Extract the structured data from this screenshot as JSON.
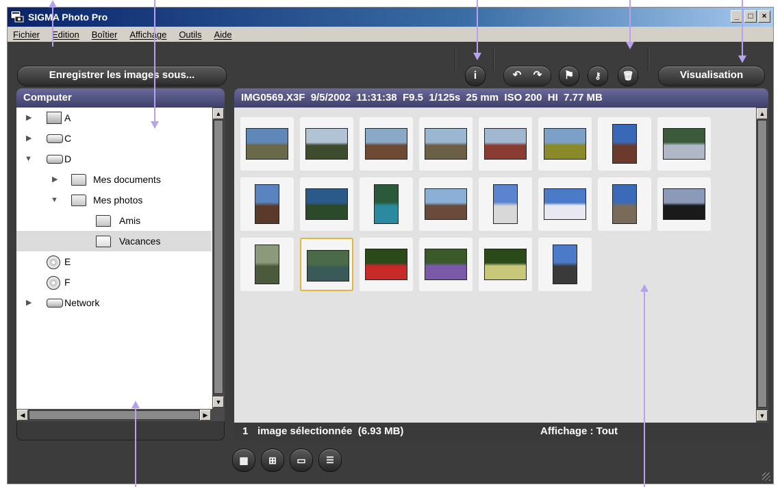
{
  "window": {
    "title": "SIGMA Photo Pro"
  },
  "menu": [
    "Fichier",
    "Edition",
    "Boîtier",
    "Affichage",
    "Outils",
    "Aide"
  ],
  "toolbar": {
    "save_label": "Enregistrer les images sous...",
    "view_label": "Visualisation",
    "icons": [
      "info-icon",
      "rotate-left-icon",
      "rotate-right-icon",
      "flag-icon",
      "key-icon",
      "trash-icon"
    ]
  },
  "tree": {
    "header": "Computer",
    "items": [
      {
        "label": "A",
        "icon": "floppy-icon",
        "expander": "collapsed"
      },
      {
        "label": "C",
        "icon": "drive-icon",
        "expander": "collapsed"
      },
      {
        "label": "D",
        "icon": "drive-icon",
        "expander": "expanded"
      },
      {
        "label": "Mes documents",
        "icon": "folder-icon",
        "expander": "collapsed"
      },
      {
        "label": "Mes photos",
        "icon": "folder-icon",
        "expander": "expanded"
      },
      {
        "label": "Amis",
        "icon": "folder-icon",
        "expander": "none"
      },
      {
        "label": "Vacances",
        "icon": "open-folder-icon",
        "expander": "none",
        "selected": true
      },
      {
        "label": "E",
        "icon": "cd-drive-icon",
        "expander": "none"
      },
      {
        "label": "F",
        "icon": "cd-drive-icon",
        "expander": "none"
      },
      {
        "label": "Network",
        "icon": "drive-icon",
        "expander": "collapsed"
      }
    ]
  },
  "image_info": "IMG0569.X3F  9/5/2002  11:31:38  F9.5  1/125s  25 mm  ISO 200  HI  7.77 MB",
  "thumbnails": [
    {
      "orient": "landscape",
      "colors": [
        "#5f88b8",
        "#6a6a4a"
      ]
    },
    {
      "orient": "landscape",
      "colors": [
        "#b0c4d6",
        "#3c4c2c"
      ]
    },
    {
      "orient": "landscape",
      "colors": [
        "#8aa8c8",
        "#6e4a34"
      ]
    },
    {
      "orient": "landscape",
      "colors": [
        "#9ab6d0",
        "#6b6046"
      ]
    },
    {
      "orient": "landscape",
      "colors": [
        "#a0b8d0",
        "#8a3c32"
      ]
    },
    {
      "orient": "landscape",
      "colors": [
        "#7da0c8",
        "#8a8a2a"
      ]
    },
    {
      "orient": "portrait",
      "colors": [
        "#3a68b8",
        "#6a3a2a"
      ]
    },
    {
      "orient": "landscape",
      "colors": [
        "#3a5a3a",
        "#b0b8c8"
      ]
    },
    {
      "orient": "portrait",
      "colors": [
        "#5a84c0",
        "#5a3a2a"
      ]
    },
    {
      "orient": "landscape",
      "colors": [
        "#2a5a8a",
        "#2a4a2a"
      ]
    },
    {
      "orient": "portrait",
      "colors": [
        "#2a5a3a",
        "#2a8aa0"
      ]
    },
    {
      "orient": "landscape",
      "colors": [
        "#8ab0d8",
        "#6a4a3a"
      ]
    },
    {
      "orient": "portrait",
      "colors": [
        "#5a84d0",
        "#d8d8d8"
      ]
    },
    {
      "orient": "landscape",
      "colors": [
        "#4a7ac8",
        "#e8e8f0"
      ]
    },
    {
      "orient": "portrait",
      "colors": [
        "#3a6ab8",
        "#7a6a5a"
      ]
    },
    {
      "orient": "landscape",
      "colors": [
        "#8a9ab8",
        "#1a1a1a"
      ]
    },
    {
      "orient": "portrait",
      "colors": [
        "#8a9a7a",
        "#4a5a3a"
      ]
    },
    {
      "orient": "landscape",
      "colors": [
        "#4a6a4a",
        "#3a5a5a"
      ],
      "selected": true
    },
    {
      "orient": "landscape",
      "colors": [
        "#2a4a1a",
        "#c82a2a"
      ]
    },
    {
      "orient": "landscape",
      "colors": [
        "#3a5a2a",
        "#7a5aa8"
      ]
    },
    {
      "orient": "landscape",
      "colors": [
        "#2a4a1a",
        "#c8c87a"
      ]
    },
    {
      "orient": "portrait",
      "colors": [
        "#4a7ac8",
        "#3a3a3a"
      ]
    }
  ],
  "status": {
    "count": "1",
    "selected_text": "image sélectionnée  (6.93 MB)",
    "view_text": "Affichage : Tout"
  },
  "view_buttons": [
    "grid-small-icon",
    "grid-large-icon",
    "single-view-icon",
    "detail-view-icon"
  ]
}
